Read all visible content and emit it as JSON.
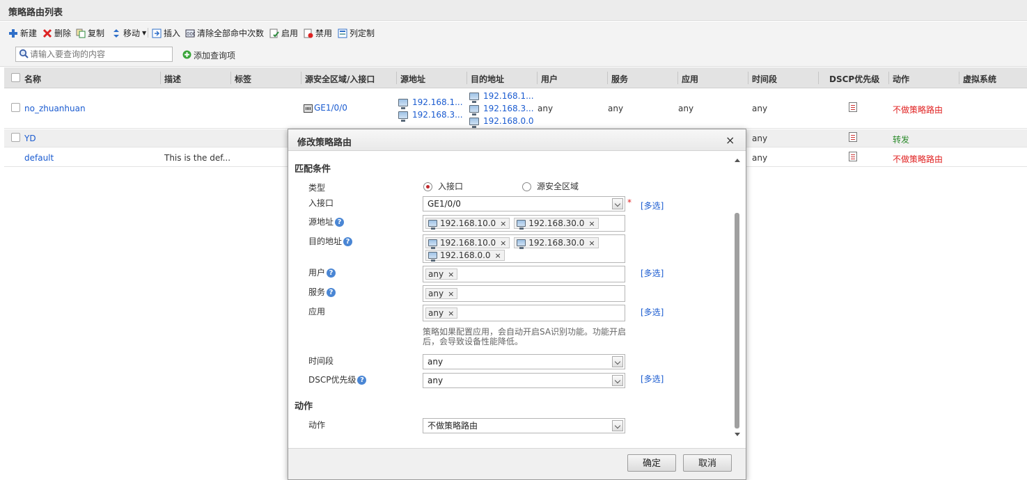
{
  "page": {
    "title": "策略路由列表"
  },
  "toolbar": {
    "new_label": "新建",
    "delete_label": "删除",
    "copy_label": "复制",
    "move_label": "移动",
    "insert_label": "插入",
    "clear_hits_label": "清除全部命中次数",
    "enable_label": "启用",
    "disable_label": "禁用",
    "columns_label": "列定制"
  },
  "search": {
    "placeholder": "请输入要查询的内容",
    "add_query_label": "添加查询项"
  },
  "table": {
    "headers": {
      "name": "名称",
      "desc": "描述",
      "tag": "标签",
      "src_zone": "源安全区域/入接口",
      "src_addr": "源地址",
      "dst_addr": "目的地址",
      "user": "用户",
      "service": "服务",
      "app": "应用",
      "time": "时间段",
      "dscp": "DSCP优先级",
      "action": "动作",
      "vsys": "虚拟系统"
    },
    "rows": [
      {
        "name": "no_zhuanhuan",
        "desc": "",
        "src_zone": "GE1/0/0",
        "src_addr": [
          "192.168.1...",
          "192.168.3..."
        ],
        "dst_addr": [
          "192.168.1...",
          "192.168.3...",
          "192.168.0.0"
        ],
        "user": "any",
        "service": "any",
        "app": "any",
        "time": "any",
        "action": "不做策略路由"
      },
      {
        "name": "YD",
        "time": "any",
        "action": "转发"
      },
      {
        "name": "default",
        "desc": "This is the def...",
        "time": "any",
        "action": "不做策略路由"
      }
    ]
  },
  "modal": {
    "title": "修改策略路由",
    "close": "×",
    "match_section": "匹配条件",
    "type_label": "类型",
    "type_opt_if": "入接口",
    "type_opt_zone": "源安全区域",
    "in_if_label": "入接口",
    "in_if_value": "GE1/0/0",
    "required_mark": "*",
    "multi_label": "[多选]",
    "src_addr_label": "源地址",
    "src_addr_tags": [
      "192.168.10.0",
      "192.168.30.0"
    ],
    "dst_addr_label": "目的地址",
    "dst_addr_tags": [
      "192.168.10.0",
      "192.168.30.0",
      "192.168.0.0"
    ],
    "user_label": "用户",
    "user_tag": "any",
    "service_label": "服务",
    "service_tag": "any",
    "app_label": "应用",
    "app_tag": "any",
    "app_note": "策略如果配置应用，会自动开启SA识别功能。功能开启后，会导致设备性能降低。",
    "time_label": "时间段",
    "time_value": "any",
    "dscp_label": "DSCP优先级",
    "dscp_value": "any",
    "action_section": "动作",
    "action_label": "动作",
    "action_value": "不做策略路由",
    "ok_label": "确定",
    "cancel_label": "取消",
    "help_mark": "?",
    "tag_remove": "×"
  },
  "colors": {
    "link": "#1a5bd0",
    "danger": "#e02020",
    "ok": "#2a8a2a",
    "radio_on": "#c0282d"
  }
}
